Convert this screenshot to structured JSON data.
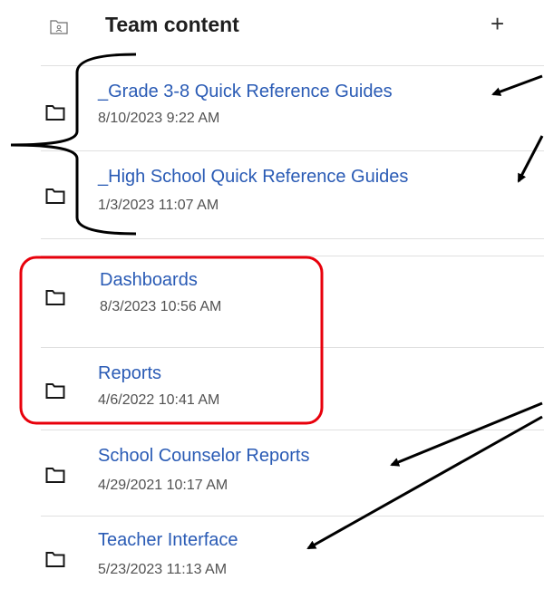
{
  "header": {
    "title": "Team content",
    "add_label": "+"
  },
  "items": [
    {
      "name": "_Grade 3-8 Quick Reference Guides",
      "date": "8/10/2023 9:22 AM"
    },
    {
      "name": "_High School Quick Reference Guides",
      "date": "1/3/2023 11:07 AM"
    },
    {
      "name": "Dashboards",
      "date": "8/3/2023 10:56 AM"
    },
    {
      "name": "Reports",
      "date": "4/6/2022 10:41 AM"
    },
    {
      "name": "School Counselor Reports",
      "date": "4/29/2021 10:17 AM"
    },
    {
      "name": "Teacher Interface",
      "date": "5/23/2023 11:13 AM"
    }
  ],
  "colors": {
    "link": "#2a5bb5",
    "annotation_box": "#e8000b",
    "annotation_ink": "#000000"
  }
}
